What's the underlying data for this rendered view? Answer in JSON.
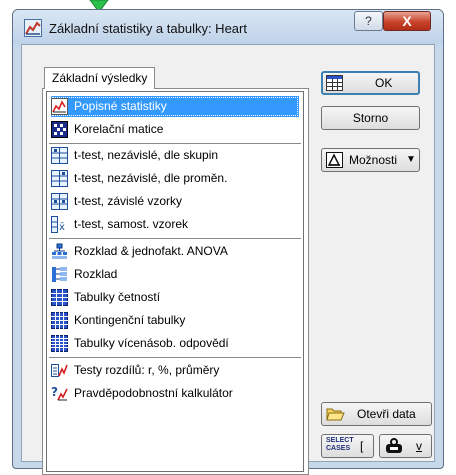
{
  "window": {
    "title": "Základní statistiky a tabulky: Heart",
    "help_glyph": "?",
    "close_glyph": "X"
  },
  "tab": {
    "label": "Základní výsledky"
  },
  "list": {
    "items": [
      {
        "label": "Popisné statistiky",
        "icon": "descriptive-stats-icon",
        "selected": true
      },
      {
        "label": "Korelační matice",
        "icon": "correlation-matrix-icon"
      },
      {
        "label": "t-test, nezávislé, dle skupin",
        "icon": "t-test-groups-icon"
      },
      {
        "label": "t-test, nezávislé, dle proměn.",
        "icon": "t-test-variables-icon"
      },
      {
        "label": "t-test, závislé vzorky",
        "icon": "t-test-dependent-icon"
      },
      {
        "label": "t-test, samost. vzorek",
        "icon": "t-test-single-icon"
      },
      {
        "label": "Rozklad & jednofakt. ANOVA",
        "icon": "breakdown-anova-icon"
      },
      {
        "label": "Rozklad",
        "icon": "breakdown-icon"
      },
      {
        "label": "Tabulky četností",
        "icon": "frequency-table-icon"
      },
      {
        "label": "Kontingenční tabulky",
        "icon": "crosstab-icon"
      },
      {
        "label": "Tabulky vícenásob. odpovědí",
        "icon": "multiple-response-icon"
      },
      {
        "label": "Testy rozdílů: r, %, průměry",
        "icon": "difference-tests-icon"
      },
      {
        "label": "Pravděpodobnostní kalkulátor",
        "icon": "probability-calculator-icon"
      }
    ]
  },
  "buttons": {
    "ok": "OK",
    "cancel": "Storno",
    "options": "Možnosti",
    "options_arrow": "▼",
    "open_data": "Otevři data",
    "select_cases_line1": "SELECT",
    "select_cases_line2": "CASES",
    "select_cases_letter": "[",
    "weights_letter": "v"
  },
  "colors": {
    "selection": "#3399ff",
    "frame": "#c7d8ea",
    "close_button": "#c8432c",
    "arrow": "#2bbf4b"
  }
}
